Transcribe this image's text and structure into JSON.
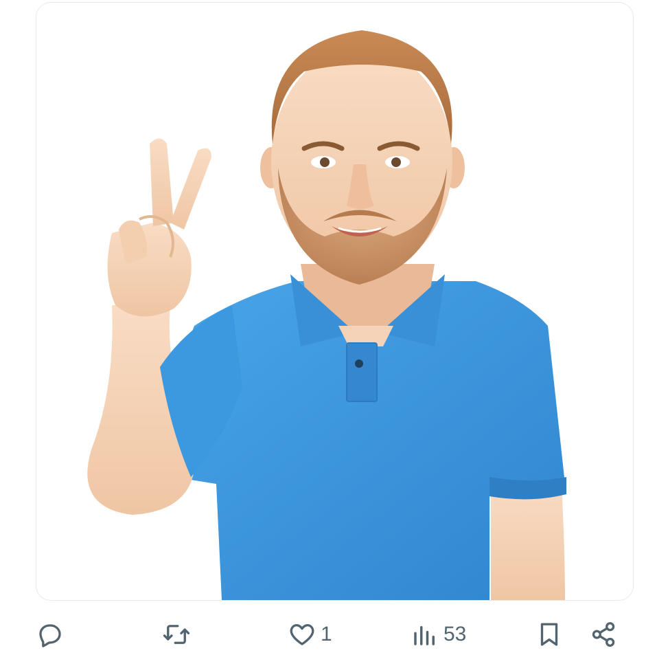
{
  "post": {
    "media": {
      "subject": "avatar-peace-sign"
    },
    "actions": {
      "reply": {
        "icon": "reply-icon"
      },
      "repost": {
        "icon": "repost-icon"
      },
      "like": {
        "icon": "heart-icon",
        "count": "1"
      },
      "views": {
        "icon": "views-icon",
        "count": "53"
      },
      "bookmark": {
        "icon": "bookmark-icon"
      },
      "share": {
        "icon": "share-icon"
      }
    }
  },
  "colors": {
    "icon_gray": "#536471",
    "shirt_blue": "#3a94dc",
    "card_border": "#e6e9ec"
  }
}
